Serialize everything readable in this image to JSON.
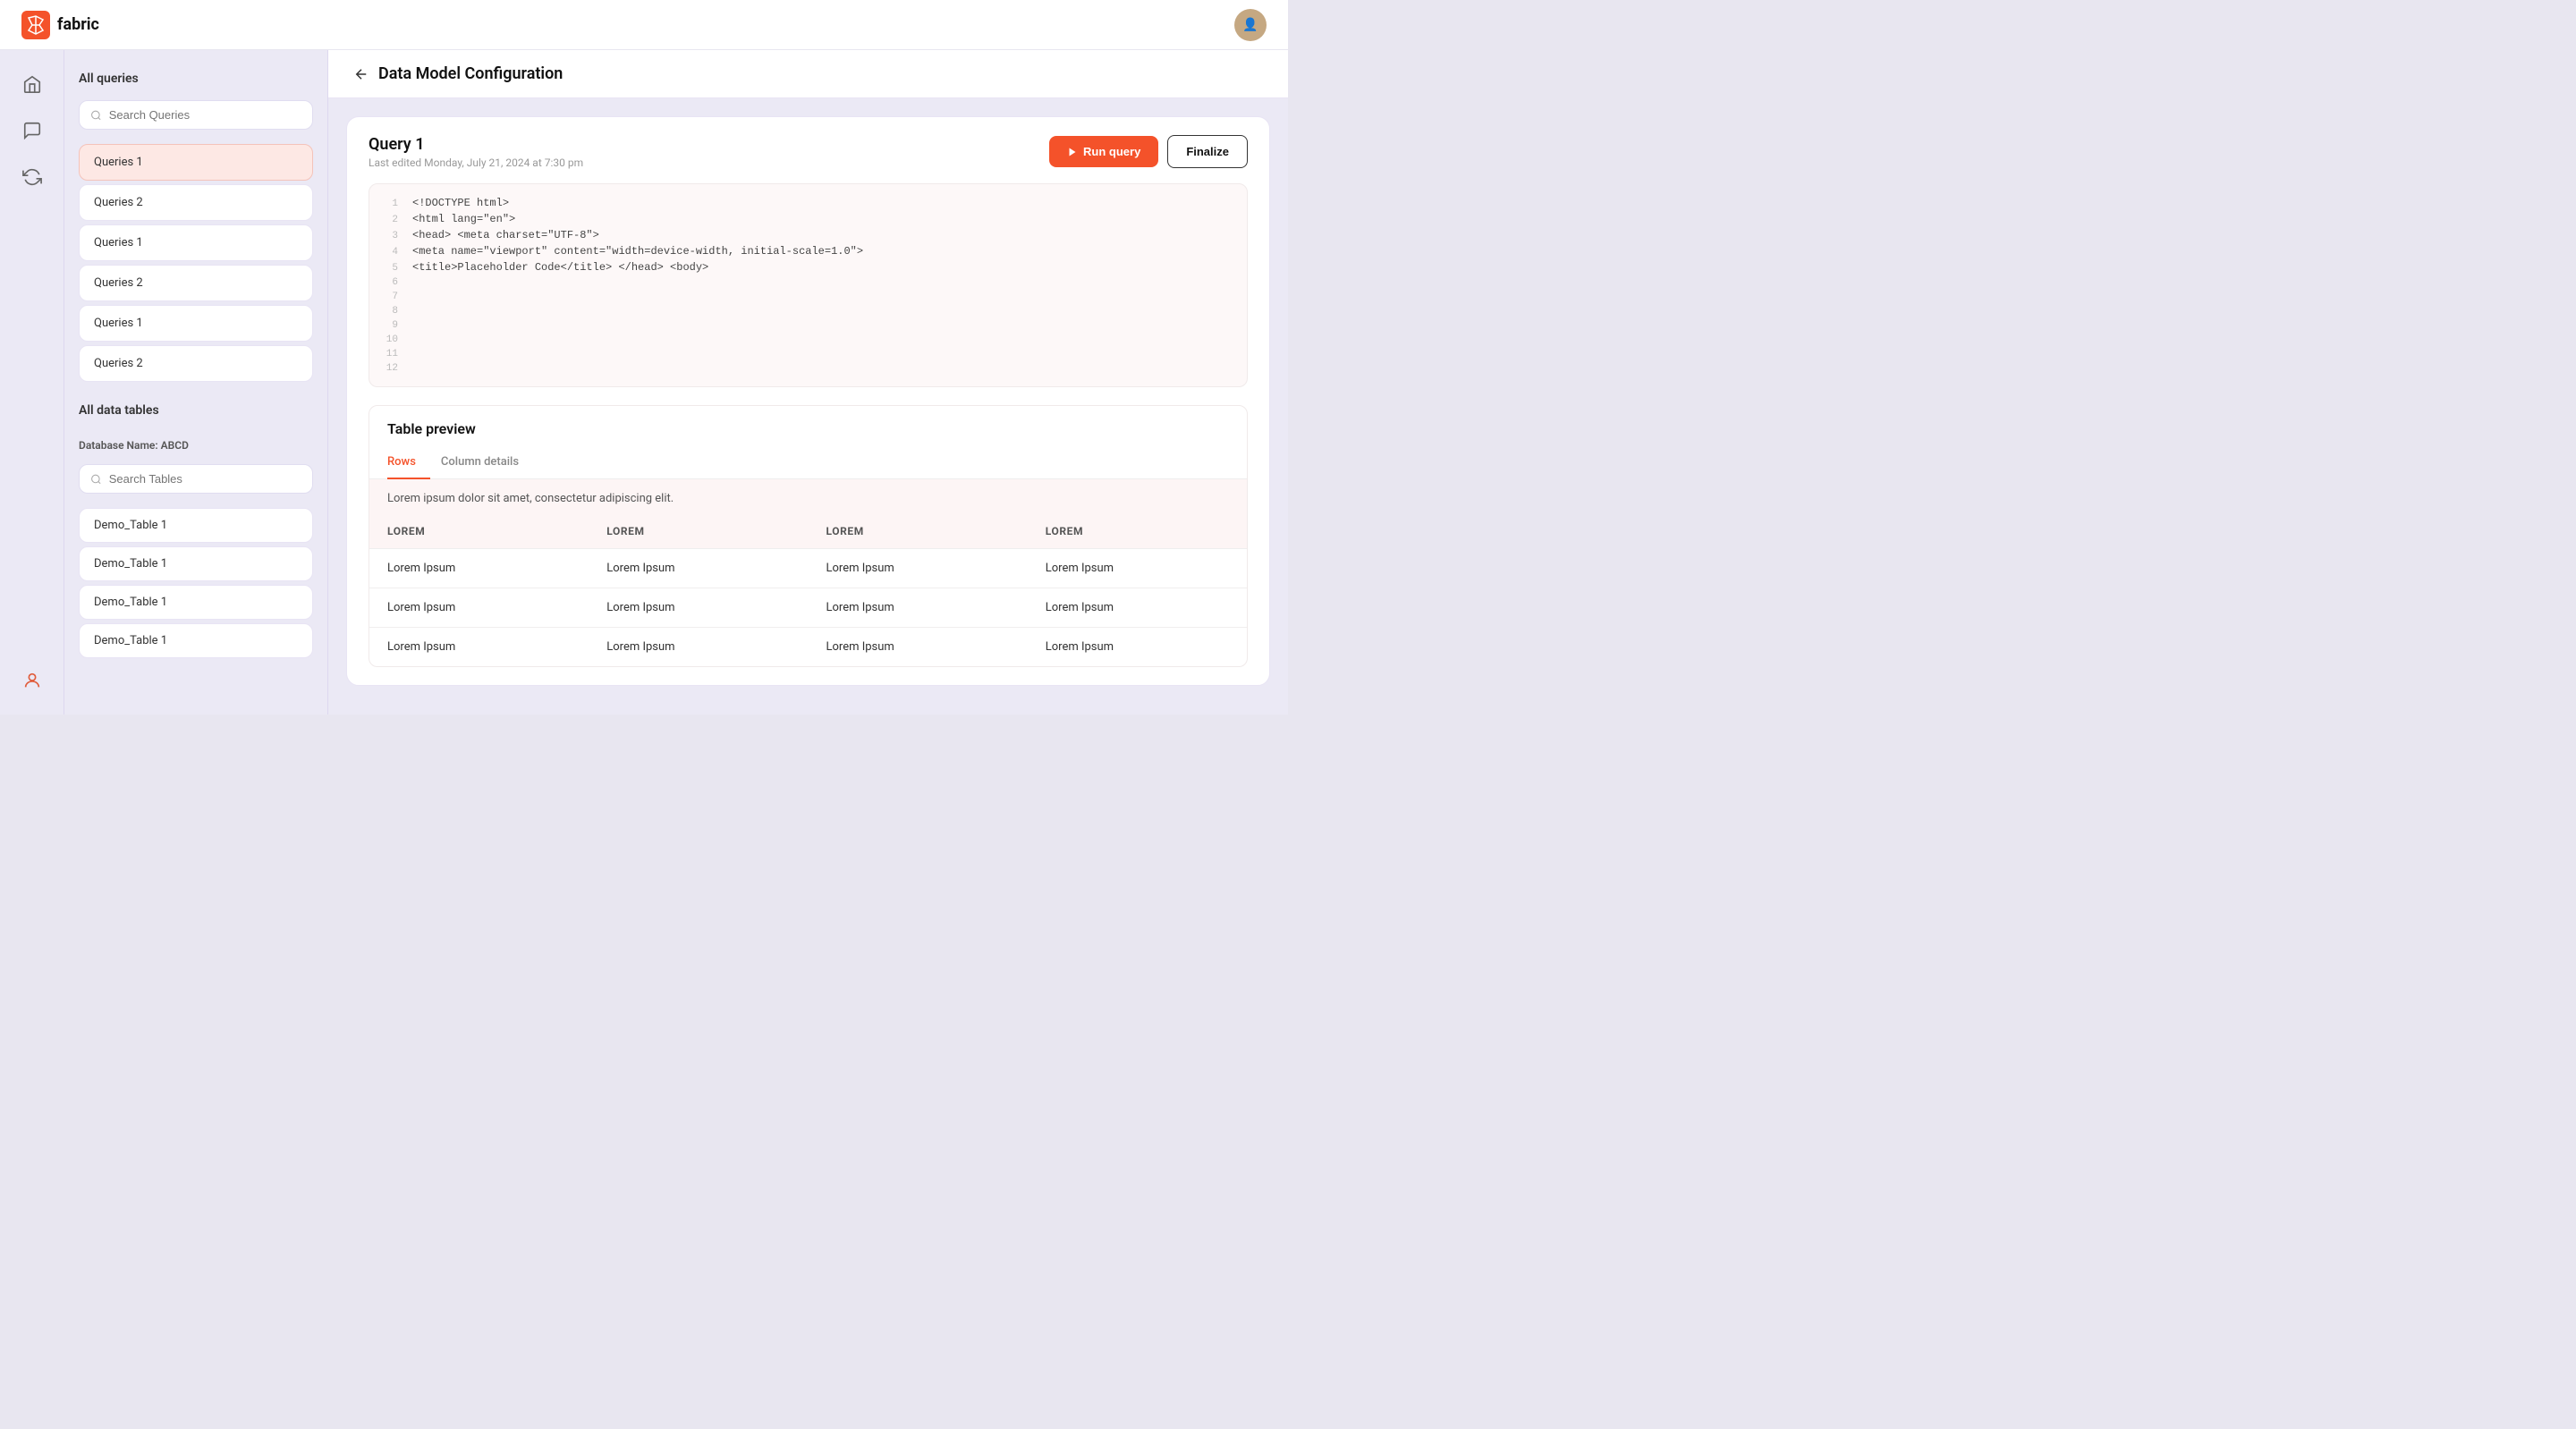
{
  "app": {
    "name": "fabric",
    "logo_text": "fabric"
  },
  "header": {
    "back_label": "←",
    "title": "Data Model Configuration"
  },
  "sidebar": {
    "nav_items": [
      {
        "icon": "🏠",
        "name": "home"
      },
      {
        "icon": "💬",
        "name": "chat"
      },
      {
        "icon": "🔄",
        "name": "refresh"
      }
    ],
    "bottom_icon": "👤"
  },
  "left_panel": {
    "all_queries_title": "All queries",
    "search_queries_placeholder": "Search Queries",
    "queries": [
      {
        "label": "Queries 1",
        "active": true
      },
      {
        "label": "Queries 2",
        "active": false
      },
      {
        "label": "Queries 1",
        "active": false
      },
      {
        "label": "Queries 2",
        "active": false
      },
      {
        "label": "Queries 1",
        "active": false
      },
      {
        "label": "Queries 2",
        "active": false
      }
    ],
    "all_data_tables_title": "All data tables",
    "database_label": "Database Name: ABCD",
    "search_tables_placeholder": "Search Tables",
    "tables": [
      {
        "label": "Demo_Table 1"
      },
      {
        "label": "Demo_Table 1"
      },
      {
        "label": "Demo_Table 1"
      },
      {
        "label": "Demo_Table 1"
      }
    ]
  },
  "main": {
    "query_name": "Query 1",
    "query_edited": "Last edited Monday, July 21, 2024 at 7:30 pm",
    "run_query_label": "Run query",
    "finalize_label": "Finalize",
    "code_lines": [
      {
        "num": 1,
        "code": "<!DOCTYPE html>"
      },
      {
        "num": 2,
        "code": "<html lang=\"en\">"
      },
      {
        "num": 3,
        "code": "<head> <meta charset=\"UTF-8\">"
      },
      {
        "num": 4,
        "code": "<meta name=\"viewport\" content=\"width=device-width, initial-scale=1.0\">"
      },
      {
        "num": 5,
        "code": "<title>Placeholder Code</title> </head> <body>"
      },
      {
        "num": 6,
        "code": ""
      },
      {
        "num": 7,
        "code": ""
      },
      {
        "num": 8,
        "code": ""
      },
      {
        "num": 9,
        "code": ""
      },
      {
        "num": 10,
        "code": ""
      },
      {
        "num": 11,
        "code": ""
      },
      {
        "num": 12,
        "code": ""
      }
    ],
    "table_preview_title": "Table preview",
    "tabs": [
      {
        "label": "Rows",
        "active": true
      },
      {
        "label": "Column details",
        "active": false
      }
    ],
    "preview_desc": "Lorem ipsum dolor sit amet, consectetur adipiscing elit.",
    "table_columns": [
      "LOREM",
      "LOREM",
      "LOREM",
      "LOREM"
    ],
    "table_rows": [
      [
        "Lorem Ipsum",
        "Lorem Ipsum",
        "Lorem Ipsum",
        "Lorem Ipsum"
      ],
      [
        "Lorem Ipsum",
        "Lorem Ipsum",
        "Lorem Ipsum",
        "Lorem Ipsum"
      ],
      [
        "Lorem Ipsum",
        "Lorem Ipsum",
        "Lorem Ipsum",
        "Lorem Ipsum"
      ]
    ]
  }
}
